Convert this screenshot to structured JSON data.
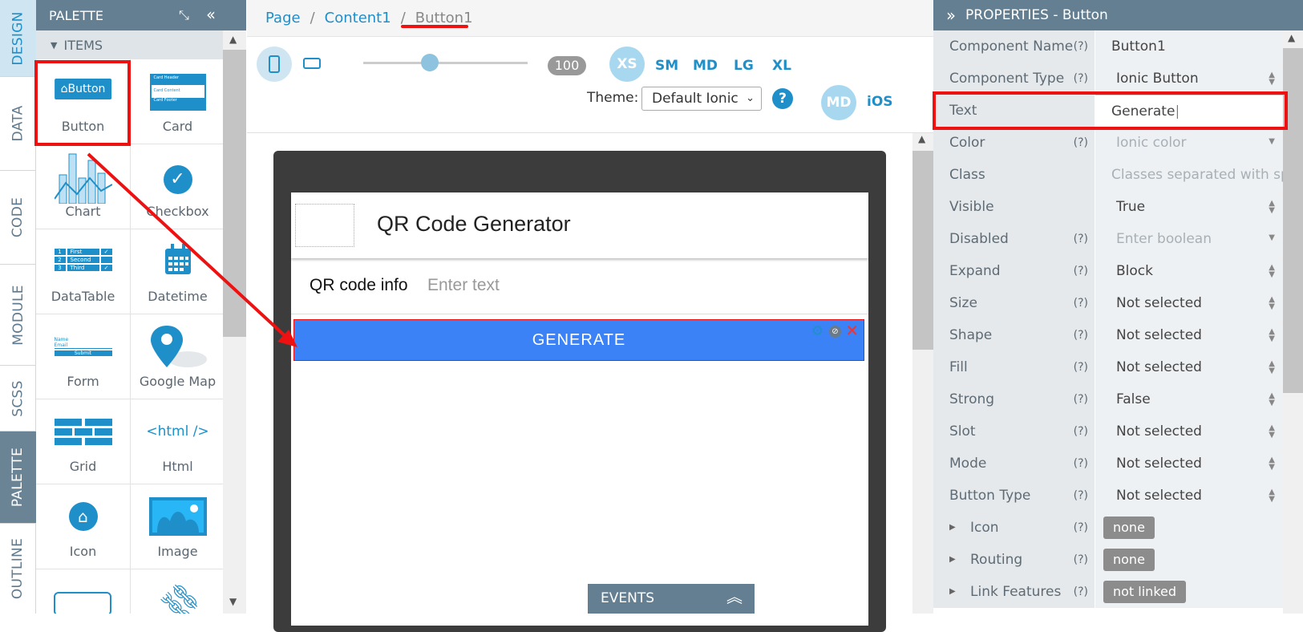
{
  "vtabs": {
    "design": "DESIGN",
    "data": "DATA",
    "code": "CODE",
    "module": "MODULE",
    "scss": "SCSS",
    "palette": "PALETTE",
    "outline": "OUTLINE"
  },
  "palette": {
    "title": "PALETTE",
    "items_header": "ITEMS",
    "items": [
      {
        "label": "Button",
        "icon_text": "Button"
      },
      {
        "label": "Card",
        "icon_lines": [
          "Card Header",
          "Card Content",
          "Card Footer"
        ]
      },
      {
        "label": "Chart"
      },
      {
        "label": "Checkbox"
      },
      {
        "label": "DataTable",
        "icon_rows": [
          [
            "1",
            "First"
          ],
          [
            "2",
            "Second"
          ],
          [
            "3",
            "Third"
          ]
        ]
      },
      {
        "label": "Datetime"
      },
      {
        "label": "Form",
        "icon_lines": [
          "Name",
          "Email",
          "Submit"
        ]
      },
      {
        "label": "Google Map"
      },
      {
        "label": "Grid"
      },
      {
        "label": "Html",
        "icon_text": "<html />"
      },
      {
        "label": "Icon"
      },
      {
        "label": "Image"
      }
    ]
  },
  "breadcrumb": {
    "page": "Page",
    "content": "Content1",
    "button": "Button1"
  },
  "toolbar": {
    "zoom": "100",
    "breakpoints": [
      "XS",
      "SM",
      "MD",
      "LG",
      "XL"
    ],
    "theme_label": "Theme:",
    "theme_value": "Default Ionic",
    "mode_md": "MD",
    "mode_ios": "iOS"
  },
  "screen": {
    "header_title": "QR Code Generator",
    "input_label": "QR code info",
    "input_placeholder": "Enter text",
    "button_text": "GENERATE"
  },
  "events_label": "EVENTS",
  "properties": {
    "title": "PROPERTIES - Button",
    "rows": [
      {
        "label": "Component Name",
        "help": "(?)",
        "value": "Button1"
      },
      {
        "label": "Component Type",
        "help": "(?)",
        "value": "Ionic Button"
      },
      {
        "label": "Text",
        "help": "",
        "value": "Generate"
      },
      {
        "label": "Color",
        "help": "(?)",
        "value": "Ionic color"
      },
      {
        "label": "Class",
        "help": "",
        "value": "Classes separated with spaces"
      },
      {
        "label": "Visible",
        "help": "",
        "value": "True"
      },
      {
        "label": "Disabled",
        "help": "(?)",
        "value": "Enter boolean"
      },
      {
        "label": "Expand",
        "help": "(?)",
        "value": "Block"
      },
      {
        "label": "Size",
        "help": "(?)",
        "value": "Not selected"
      },
      {
        "label": "Shape",
        "help": "(?)",
        "value": "Not selected"
      },
      {
        "label": "Fill",
        "help": "(?)",
        "value": "Not selected"
      },
      {
        "label": "Strong",
        "help": "(?)",
        "value": "False"
      },
      {
        "label": "Slot",
        "help": "(?)",
        "value": "Not selected"
      },
      {
        "label": "Mode",
        "help": "(?)",
        "value": "Not selected"
      },
      {
        "label": "Button Type",
        "help": "(?)",
        "value": "Not selected"
      },
      {
        "label": "Icon",
        "help": "(?)",
        "value": "none"
      },
      {
        "label": "Routing",
        "help": "(?)",
        "value": "none"
      },
      {
        "label": "Link Features",
        "help": "(?)",
        "value": "not linked"
      }
    ]
  },
  "colors": {
    "accent": "#1f8fc9",
    "header_bar": "#647f92",
    "button_blue": "#3b82f6",
    "annotation_red": "#ee1111"
  }
}
